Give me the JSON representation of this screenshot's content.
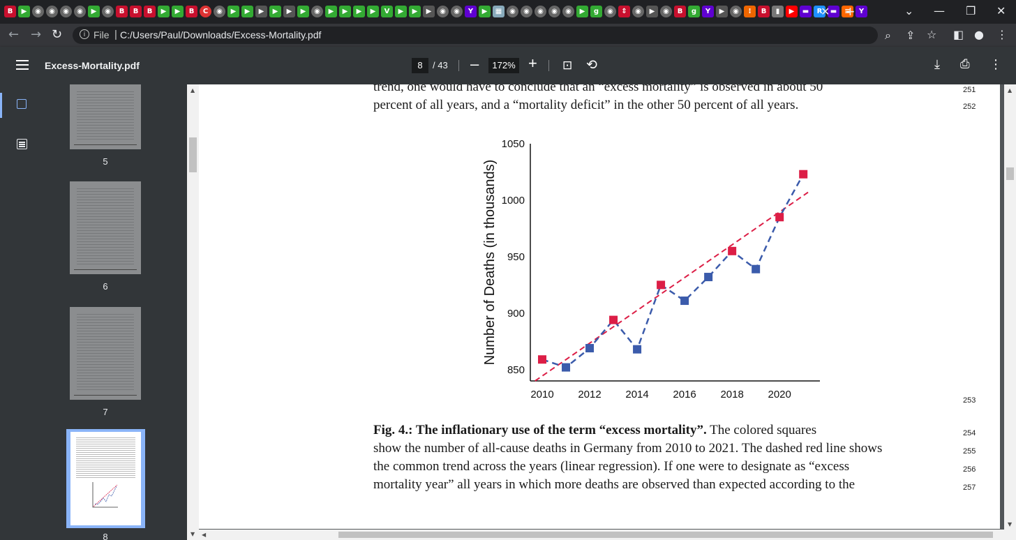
{
  "browser": {
    "tab_close": "✕",
    "new_tab": "+",
    "url_scheme_label": "File",
    "url": "C:/Users/Paul/Downloads/Excess-Mortality.pdf"
  },
  "pdf_toolbar": {
    "title": "Excess-Mortality.pdf",
    "current_page": "8",
    "total_pages": "/ 43",
    "zoom": "172%"
  },
  "sidebar": {
    "thumbnails": [
      {
        "label": "5"
      },
      {
        "label": "6"
      },
      {
        "label": "7"
      },
      {
        "label": "8",
        "selected": true
      }
    ]
  },
  "page": {
    "top_lines": [
      "trend, one would have to conclude that an “excess mortality” is observed in about 50",
      "percent of all years, and a “mortality deficit” in the other 50 percent of all years."
    ],
    "top_line_numbers": [
      "251",
      "252"
    ],
    "figure_line_number": "253",
    "caption_lines": [
      {
        "bold": "Fig. 4.: The inflationary use of the term “excess mortality”.",
        "rest": " The colored squares"
      },
      {
        "bold": "",
        "rest": "show the number of all-cause deaths in Germany from 2010 to 2021. The dashed red line shows"
      },
      {
        "bold": "",
        "rest": "the common trend across the years (linear regression). If one were to designate as “excess"
      },
      {
        "bold": "",
        "rest": "mortality year” all years in which more deaths are observed than expected according to the"
      }
    ],
    "caption_line_numbers": [
      "254",
      "255",
      "256",
      "257"
    ]
  },
  "chart_data": {
    "type": "scatter",
    "title": "",
    "xlabel": "",
    "ylabel": "Number of Deaths (in thousands)",
    "x_ticks": [
      "2010",
      "2012",
      "2014",
      "2016",
      "2018",
      "2020"
    ],
    "y_ticks": [
      "850",
      "900",
      "950",
      "1000",
      "1050"
    ],
    "xlim": [
      2009.5,
      2021.7
    ],
    "ylim": [
      840,
      1050
    ],
    "points": [
      {
        "x": 2010,
        "y": 859,
        "above_trend": true
      },
      {
        "x": 2011,
        "y": 852,
        "above_trend": false
      },
      {
        "x": 2012,
        "y": 869,
        "above_trend": false
      },
      {
        "x": 2013,
        "y": 894,
        "above_trend": true
      },
      {
        "x": 2014,
        "y": 868,
        "above_trend": false
      },
      {
        "x": 2015,
        "y": 925,
        "above_trend": true
      },
      {
        "x": 2016,
        "y": 911,
        "above_trend": false
      },
      {
        "x": 2017,
        "y": 932,
        "above_trend": false
      },
      {
        "x": 2018,
        "y": 955,
        "above_trend": true
      },
      {
        "x": 2019,
        "y": 939,
        "above_trend": false
      },
      {
        "x": 2020,
        "y": 985,
        "above_trend": true
      },
      {
        "x": 2021,
        "y": 1023,
        "above_trend": true
      }
    ],
    "trend": {
      "x": [
        2009.7,
        2021.2
      ],
      "y": [
        840,
        1007
      ]
    },
    "colors": {
      "above": "#dc1e46",
      "below": "#3b5bab",
      "trend": "#dc1e46"
    }
  }
}
